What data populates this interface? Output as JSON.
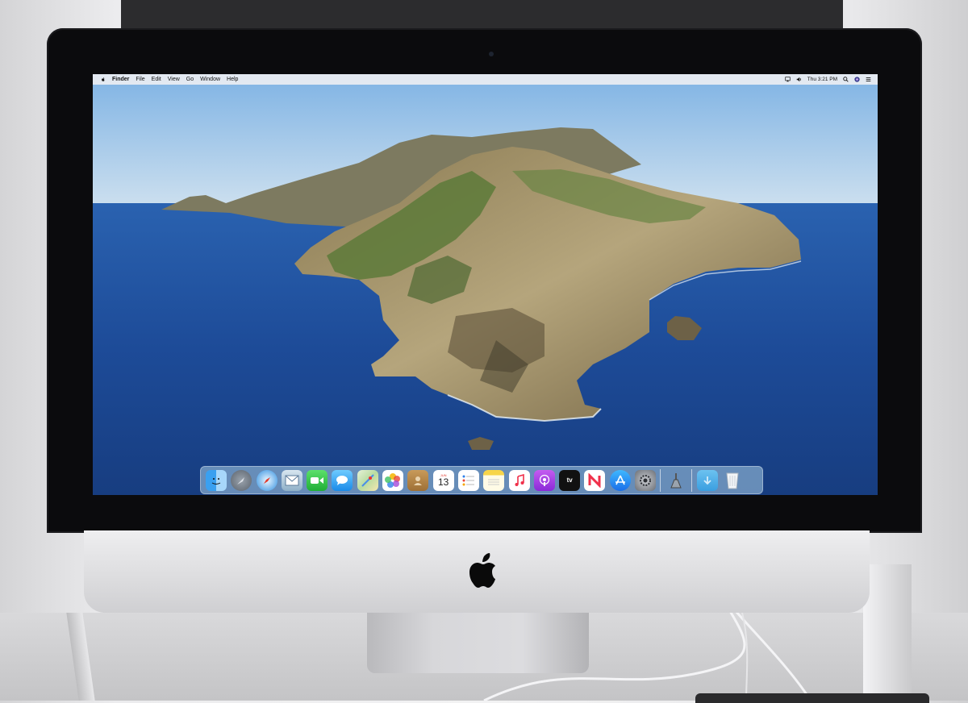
{
  "menubar": {
    "app_name": "Finder",
    "menus": [
      "File",
      "Edit",
      "View",
      "Go",
      "Window",
      "Help"
    ],
    "clock": "Thu 3:21 PM"
  },
  "dock": {
    "calendar": {
      "month": "JUN",
      "day": "13"
    },
    "tv_label": "tv",
    "apps": [
      "Finder",
      "Launchpad",
      "Safari",
      "Mail",
      "FaceTime",
      "Messages",
      "Maps",
      "Photos",
      "Contacts",
      "Calendar",
      "Reminders",
      "Notes",
      "Music",
      "Podcasts",
      "TV",
      "News",
      "App Store",
      "System Preferences",
      "Utilities",
      "Downloads",
      "Trash"
    ]
  },
  "colors": {
    "sky": "#9cc6ec",
    "sea": "#1e4c9c",
    "menubar": "#eceef2",
    "dock": "#aacde6"
  }
}
